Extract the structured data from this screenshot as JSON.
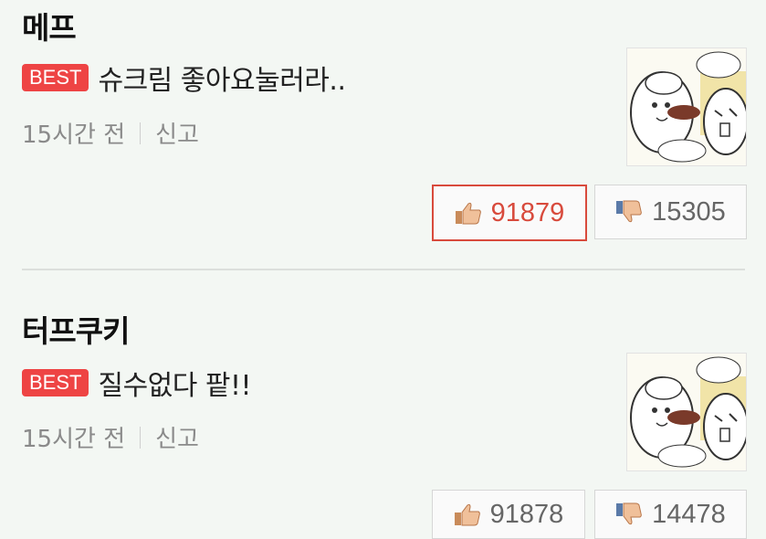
{
  "comments": [
    {
      "nickname": "메프",
      "badge": "BEST",
      "title": "슈크림 좋아요눌러라..",
      "time": "15시간 전",
      "report": "신고",
      "likes": "91879",
      "dislikes": "15305",
      "liked": true
    },
    {
      "nickname": "터프쿠키",
      "badge": "BEST",
      "title": "질수없다 팥!!",
      "time": "15시간 전",
      "report": "신고",
      "likes": "91878",
      "dislikes": "14478",
      "liked": false
    }
  ],
  "colors": {
    "badge": "#ee4444",
    "liked_border": "#d84a3c",
    "background": "#f3f7f3"
  },
  "icons": [
    "thumbs-up-icon",
    "thumbs-down-icon"
  ]
}
